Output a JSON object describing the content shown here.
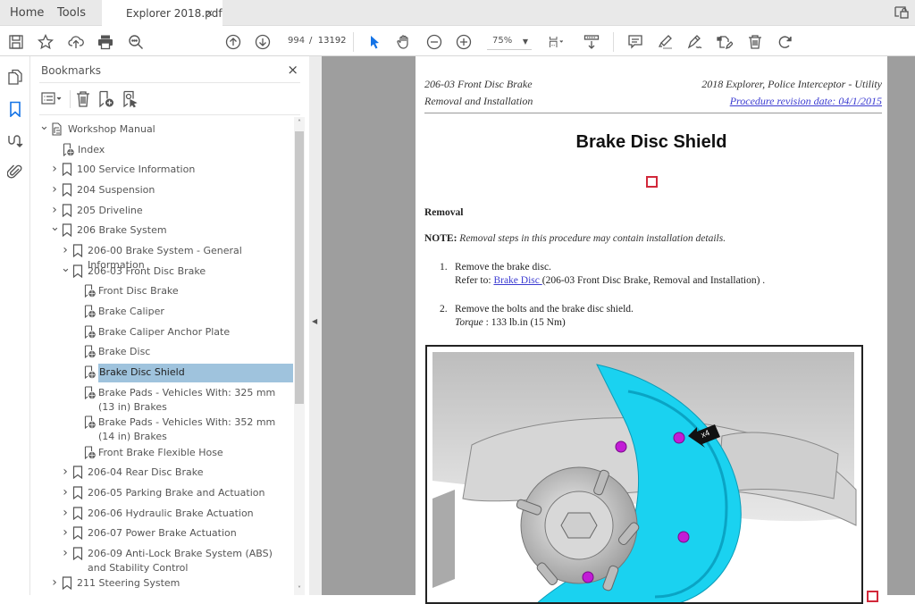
{
  "tabbar": {
    "home": "Home",
    "tools": "Tools",
    "document_tab": "Explorer 2018.pdf",
    "close_tab": "×"
  },
  "toolbar": {
    "page_current": "994",
    "page_separator": "/",
    "page_total": "13192",
    "zoom_level": "75%",
    "icons": [
      "save-icon",
      "bookmark-star-icon",
      "upload-cloud-icon",
      "print-icon",
      "search-zoom-icon",
      "page-up-icon",
      "page-down-icon",
      "select-cursor-icon",
      "hand-icon",
      "zoom-out-icon",
      "zoom-in-icon",
      "fit-page-icon",
      "scroll-mode-icon",
      "comment-icon",
      "highlight-icon",
      "sign-icon",
      "fill-sign-icon",
      "delete-icon",
      "rotate-icon"
    ]
  },
  "bookmarks": {
    "title": "Bookmarks",
    "close": "×",
    "items": [
      {
        "label": "Workshop Manual",
        "level": 0,
        "state": "expanded",
        "icon": "document-tree-icon"
      },
      {
        "label": "Index",
        "level": 1,
        "state": "leaf",
        "icon": "web-bookmark-icon"
      },
      {
        "label": "100 Service Information",
        "level": 1,
        "state": "collapsed",
        "icon": "bookmark-icon"
      },
      {
        "label": "204 Suspension",
        "level": 1,
        "state": "collapsed",
        "icon": "bookmark-icon"
      },
      {
        "label": "205 Driveline",
        "level": 1,
        "state": "collapsed",
        "icon": "bookmark-icon"
      },
      {
        "label": "206 Brake System",
        "level": 1,
        "state": "expanded",
        "icon": "bookmark-icon"
      },
      {
        "label": "206-00 Brake System - General Information",
        "level": 2,
        "state": "collapsed",
        "icon": "bookmark-icon"
      },
      {
        "label": "206-03 Front Disc Brake",
        "level": 2,
        "state": "expanded",
        "icon": "bookmark-icon"
      },
      {
        "label": "Front Disc Brake",
        "level": 3,
        "state": "leaf",
        "icon": "web-bookmark-icon"
      },
      {
        "label": "Brake Caliper",
        "level": 3,
        "state": "leaf",
        "icon": "web-bookmark-icon"
      },
      {
        "label": "Brake Caliper Anchor Plate",
        "level": 3,
        "state": "leaf",
        "icon": "web-bookmark-icon"
      },
      {
        "label": "Brake Disc",
        "level": 3,
        "state": "leaf",
        "icon": "web-bookmark-icon"
      },
      {
        "label": "Brake Disc Shield",
        "level": 3,
        "state": "leaf",
        "icon": "web-bookmark-icon",
        "selected": true
      },
      {
        "label": "Brake Pads - Vehicles With: 325 mm (13 in) Brakes",
        "level": 3,
        "state": "leaf",
        "icon": "web-bookmark-icon"
      },
      {
        "label": "Brake Pads - Vehicles With: 352 mm (14 in) Brakes",
        "level": 3,
        "state": "leaf",
        "icon": "web-bookmark-icon"
      },
      {
        "label": "Front Brake Flexible Hose",
        "level": 3,
        "state": "leaf",
        "icon": "web-bookmark-icon"
      },
      {
        "label": "206-04 Rear Disc Brake",
        "level": 2,
        "state": "collapsed",
        "icon": "bookmark-icon"
      },
      {
        "label": "206-05 Parking Brake and Actuation",
        "level": 2,
        "state": "collapsed",
        "icon": "bookmark-icon"
      },
      {
        "label": "206-06 Hydraulic Brake Actuation",
        "level": 2,
        "state": "collapsed",
        "icon": "bookmark-icon"
      },
      {
        "label": "206-07 Power Brake Actuation",
        "level": 2,
        "state": "collapsed",
        "icon": "bookmark-icon"
      },
      {
        "label": "206-09 Anti-Lock Brake System (ABS) and Stability Control",
        "level": 2,
        "state": "collapsed",
        "icon": "bookmark-icon"
      },
      {
        "label": "211 Steering System",
        "level": 1,
        "state": "collapsed",
        "icon": "bookmark-icon"
      }
    ]
  },
  "document": {
    "header_left_line1": "206-03 Front Disc Brake",
    "header_left_line2": "Removal and Installation",
    "header_right_line1": "2018 Explorer, Police Interceptor - Utility",
    "header_right_link": "Procedure revision date: 04/1/2015",
    "title": "Brake Disc Shield",
    "section": "Removal",
    "note_label": "NOTE:",
    "note_text": "Removal steps in this procedure may contain installation details.",
    "steps": [
      {
        "num": "1.",
        "text": "Remove the brake disc.",
        "refer_prefix": "Refer to: ",
        "refer_link": "Brake Disc ",
        "refer_suffix": "(206-03 Front Disc Brake, Removal and Installation) ."
      },
      {
        "num": "2.",
        "text": "Remove the bolts and the brake disc shield.",
        "torque_label": "Torque",
        "torque_value": " : 133 lb.in (15 Nm)"
      }
    ],
    "figure_callout": "x4",
    "colors": {
      "link": "#3b3bd1",
      "shield": "#1ad2f0",
      "bolt": "#c21cd6",
      "marker": "#d2283a",
      "selection": "#9fc3dd",
      "accent": "#1473e6"
    }
  }
}
